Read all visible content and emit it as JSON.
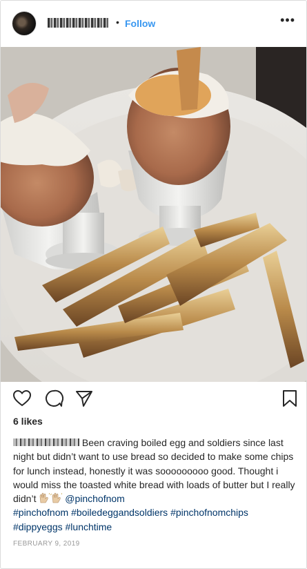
{
  "header": {
    "username": "••••••••••",
    "separator": "•",
    "follow_label": "Follow",
    "more_label": "•••"
  },
  "photo": {
    "icon": "photo"
  },
  "actions": {
    "like_icon": "heart-icon",
    "comment_icon": "comment-icon",
    "share_icon": "share-icon",
    "save_icon": "bookmark-icon"
  },
  "likes": "6 likes",
  "caption": {
    "username": "••••••••",
    "text_1": " Been craving boiled egg and soldiers since last night but didn’t want to use bread so decided to make some chips for lunch instead, honestly it was sooooooooo good. Thought i would miss the toasted white bread with loads of butter but I really didn’t ",
    "emoji": "raising-hands-emoji",
    "mention": "@pinchofnom",
    "hashtags": [
      "#pinchofnom",
      "#boiledeggandsoldiers",
      "#pinchofnomchips",
      "#dippyeggs",
      "#lunchtime"
    ]
  },
  "date": "FEBRUARY 9, 2019",
  "colors": {
    "link": "#3897f0",
    "hashtag": "#003569",
    "text": "#262626",
    "muted": "#999999"
  }
}
